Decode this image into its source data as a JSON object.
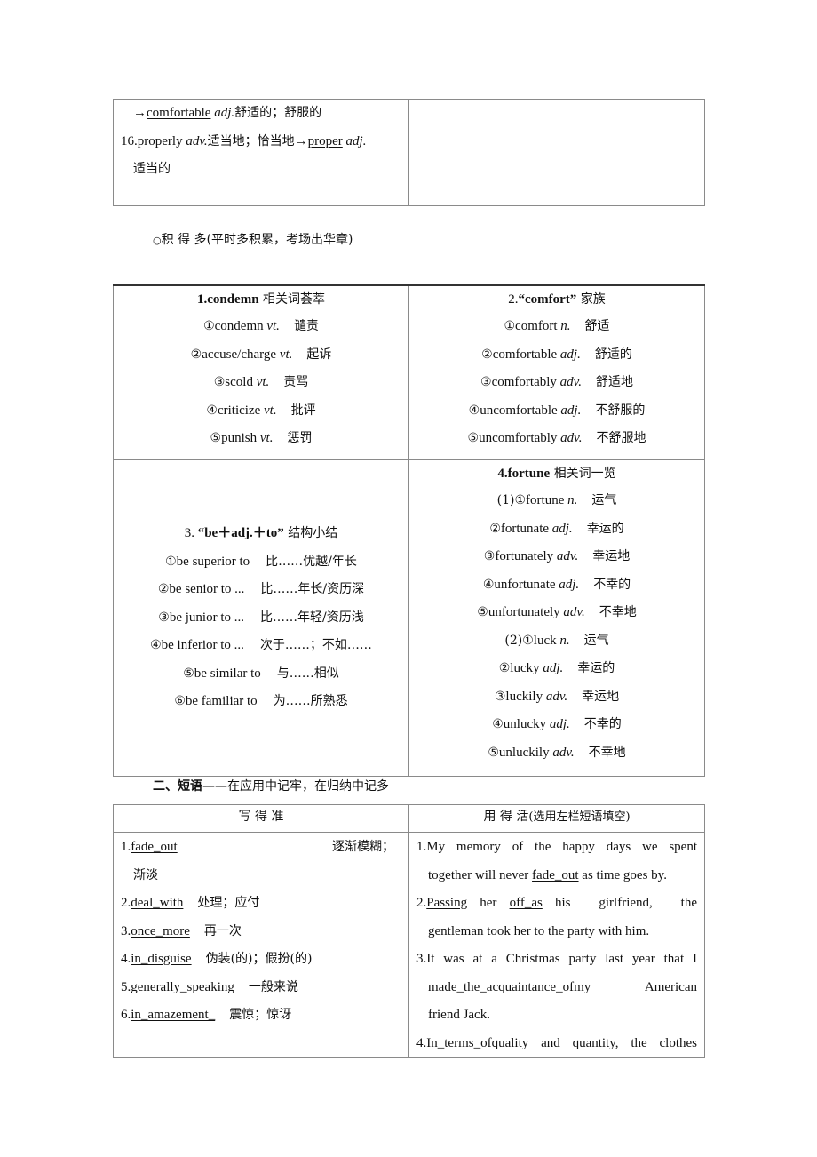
{
  "table1": {
    "left_lines": [
      {
        "arrow": "→",
        "word": "comfortable",
        "pos": "adj.",
        "meaning": "舒适的；舒服的"
      },
      {
        "prefix": "16.properly ",
        "pos": "adv.",
        "meaning": "适当地；恰当地",
        "arrow": "→",
        "word": "proper",
        "pos2": "adj."
      },
      {
        "meaning": "适当的"
      }
    ]
  },
  "section_note": {
    "icon": "○",
    "title": "积 得 多",
    "subtitle": "(平时多积累，考场出华章)"
  },
  "table2": {
    "condemn": {
      "title_bold": "1.condemn",
      "title_rest": " 相关词荟萃",
      "items": [
        {
          "mark": "①",
          "word": "condemn",
          "pos": "vt.",
          "meaning": "谴责"
        },
        {
          "mark": "②",
          "word": "accuse/charge",
          "pos": "vt.",
          "meaning": "起诉"
        },
        {
          "mark": "③",
          "word": "scold",
          "pos": "vt.",
          "meaning": "责骂"
        },
        {
          "mark": "④",
          "word": "criticize",
          "pos": "vt.",
          "meaning": "批评"
        },
        {
          "mark": "⑤",
          "word": "punish",
          "pos": "vt.",
          "meaning": "惩罚"
        }
      ]
    },
    "comfort": {
      "title_num": "2.",
      "title_bold": "“comfort”",
      "title_rest": " 家族",
      "items": [
        {
          "mark": "①",
          "word": "comfort",
          "pos": "n.",
          "meaning": "舒适"
        },
        {
          "mark": "②",
          "word": "comfortable",
          "pos": "adj.",
          "meaning": "舒适的"
        },
        {
          "mark": "③",
          "word": "comfortably",
          "pos": "adv.",
          "meaning": "舒适地"
        },
        {
          "mark": "④",
          "word": "uncomfortable",
          "pos": "adj.",
          "meaning": "不舒服的"
        },
        {
          "mark": "⑤",
          "word": "uncomfortably",
          "pos": "adv.",
          "meaning": "不舒服地"
        }
      ]
    },
    "be_adj_to": {
      "title_num": "3. ",
      "title_bold": "“be＋adj.＋to”",
      "title_rest": " 结构小结",
      "items": [
        {
          "mark": "①",
          "phrase": "be superior to",
          "meaning": "比……优越/年长"
        },
        {
          "mark": "②",
          "phrase": "be senior to ...",
          "meaning": "比……年长/资历深"
        },
        {
          "mark": "③",
          "phrase": "be junior to ...",
          "meaning": "比……年轻/资历浅"
        },
        {
          "mark": "④",
          "phrase": "be inferior to ...",
          "meaning": "次于……；不如……"
        },
        {
          "mark": "⑤",
          "phrase": "be similar to",
          "meaning": "与……相似"
        },
        {
          "mark": "⑥",
          "phrase": "be familiar to",
          "meaning": "为……所熟悉"
        }
      ]
    },
    "fortune": {
      "title_bold": "4.fortune",
      "title_rest": " 相关词一览",
      "items": [
        {
          "mark": "(1)①",
          "word": "fortune",
          "pos": "n.",
          "meaning": "运气"
        },
        {
          "mark": "②",
          "word": "fortunate",
          "pos": "adj.",
          "meaning": "幸运的"
        },
        {
          "mark": "③",
          "word": "fortunately",
          "pos": "adv.",
          "meaning": "幸运地"
        },
        {
          "mark": "④",
          "word": "unfortunate",
          "pos": "adj.",
          "meaning": "不幸的"
        },
        {
          "mark": "⑤",
          "word": "unfortunately",
          "pos": "adv.",
          "meaning": "不幸地"
        },
        {
          "mark": "(2)①",
          "word": "luck",
          "pos": "n.",
          "meaning": "运气"
        },
        {
          "mark": "②",
          "word": "lucky",
          "pos": "adj.",
          "meaning": "幸运的"
        },
        {
          "mark": "③",
          "word": "luckily",
          "pos": "adv.",
          "meaning": "幸运地"
        },
        {
          "mark": "④",
          "word": "unlucky",
          "pos": "adj.",
          "meaning": "不幸的"
        },
        {
          "mark": "⑤",
          "word": "unluckily",
          "pos": "adv.",
          "meaning": "不幸地"
        }
      ]
    }
  },
  "phrases_heading": {
    "bold": "二、短语",
    "rest": "——在应用中记牢，在归纳中记多"
  },
  "table3": {
    "left_header": "写 得 准",
    "right_header_main": "用 得 活",
    "right_header_note": "(选用左栏短语填空)",
    "left_items": [
      {
        "num": "1.",
        "phrase": "fade_out",
        "meaning": "逐渐模糊；",
        "meaning2": "渐淡"
      },
      {
        "num": "2.",
        "phrase": "deal_with",
        "meaning": "处理；应付"
      },
      {
        "num": "3.",
        "phrase": "once_more",
        "meaning": "再一次"
      },
      {
        "num": "4.",
        "phrase": "in_disguise",
        "meaning": "伪装(的)；假扮(的)"
      },
      {
        "num": "5.",
        "phrase": "generally_speaking",
        "meaning": "一般来说"
      },
      {
        "num": "6.",
        "phrase": "in_amazement_",
        "meaning": "震惊；惊讶"
      }
    ],
    "right_items": [
      {
        "line1": "1.My memory of the happy days we spent",
        "line2_pre": "together will never ",
        "line2_u": "fade_out",
        "line2_post": " as time goes by."
      },
      {
        "l1_num": "2.",
        "l1_u1": "Passing",
        "l1_mid": "her",
        "l1_u2": "off_as",
        "l1_rest": "his girlfriend, the",
        "line2": "gentleman took her to the party with him."
      },
      {
        "line1": "3.It was at a Christmas party last year that I",
        "line2_u": "made_the_acquaintance_of",
        "line2_rest": "my American",
        "line3": "friend Jack."
      },
      {
        "num": "4.",
        "u": "In_terms_of",
        "rest": " quality and quantity, the clothes"
      }
    ]
  }
}
